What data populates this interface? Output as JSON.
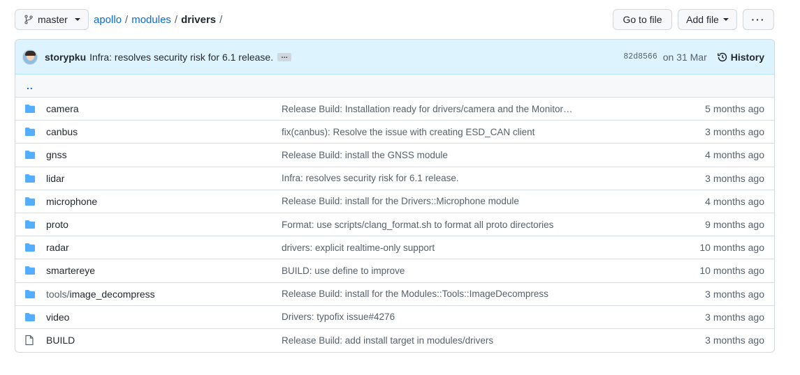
{
  "branch": {
    "label": "master"
  },
  "breadcrumb": {
    "root": "apollo",
    "parent": "modules",
    "current": "drivers",
    "sep": "/"
  },
  "actions": {
    "go_to_file": "Go to file",
    "add_file": "Add file",
    "more": "···"
  },
  "commit": {
    "author": "storypku",
    "message": "Infra: resolves security risk for 6.1 release.",
    "expand": "…",
    "sha": "82d8566",
    "date": "on 31 Mar",
    "history_label": "History"
  },
  "up_link": "..",
  "files": [
    {
      "type": "dir",
      "prefix": "",
      "name": "camera",
      "message": "Release Build: Installation ready for drivers/camera and the Monitor …",
      "age": "5 months ago"
    },
    {
      "type": "dir",
      "prefix": "",
      "name": "canbus",
      "message": "fix(canbus): Resolve the issue with creating ESD_CAN client",
      "age": "3 months ago"
    },
    {
      "type": "dir",
      "prefix": "",
      "name": "gnss",
      "message": "Release Build: install the GNSS module",
      "age": "4 months ago"
    },
    {
      "type": "dir",
      "prefix": "",
      "name": "lidar",
      "message": "Infra: resolves security risk for 6.1 release.",
      "age": "3 months ago"
    },
    {
      "type": "dir",
      "prefix": "",
      "name": "microphone",
      "message": "Release Build: install for the Drivers::Microphone module",
      "age": "4 months ago"
    },
    {
      "type": "dir",
      "prefix": "",
      "name": "proto",
      "message": "Format: use scripts/clang_format.sh to format all proto directories",
      "age": "9 months ago"
    },
    {
      "type": "dir",
      "prefix": "",
      "name": "radar",
      "message": "drivers: explicit realtime-only support",
      "age": "10 months ago"
    },
    {
      "type": "dir",
      "prefix": "",
      "name": "smartereye",
      "message": "BUILD: use define to improve",
      "age": "10 months ago"
    },
    {
      "type": "dir",
      "prefix": "tools/",
      "name": "image_decompress",
      "message": "Release Build: install for the Modules::Tools::ImageDecompress",
      "age": "3 months ago"
    },
    {
      "type": "dir",
      "prefix": "",
      "name": "video",
      "message": "Drivers: typofix issue#4276",
      "age": "3 months ago"
    },
    {
      "type": "file",
      "prefix": "",
      "name": "BUILD",
      "message": "Release Build: add install target in modules/drivers",
      "age": "3 months ago"
    }
  ],
  "colors": {
    "folder": "#54aeff",
    "link": "#0969da",
    "commit_bg": "#ddf4ff"
  }
}
